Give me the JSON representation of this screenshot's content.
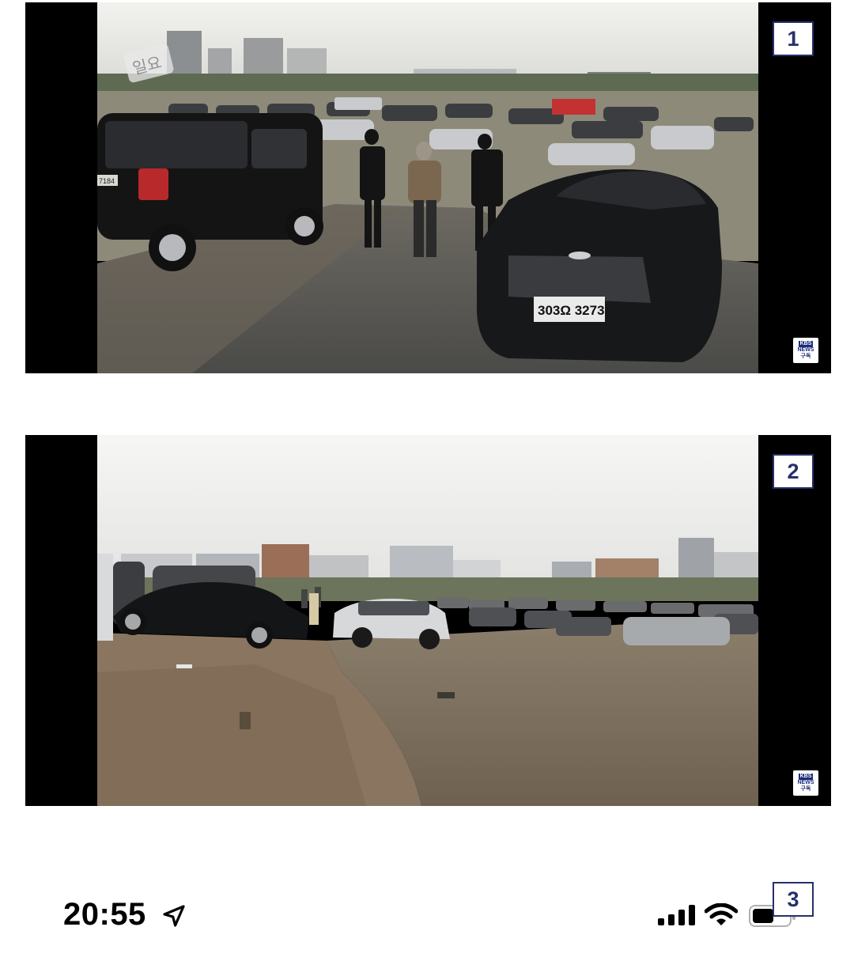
{
  "screenshots": [
    {
      "badge": "1",
      "plate_text": "303Ω 3273",
      "plate_left": "7184",
      "logo_top": "KBS",
      "logo_mid": "NEWS",
      "logo_bottom": "구독",
      "watermark": "일요"
    },
    {
      "badge": "2",
      "logo_top": "KBS",
      "logo_mid": "NEWS",
      "logo_bottom": "구독"
    }
  ],
  "status_bar": {
    "time": "20:55",
    "badge": "3",
    "icons": [
      "location-arrow-icon",
      "cellular-signal-icon",
      "wifi-icon",
      "battery-icon"
    ]
  }
}
